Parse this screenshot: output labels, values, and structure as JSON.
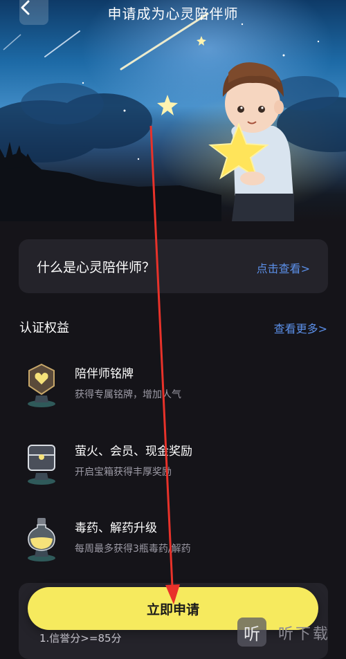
{
  "header": {
    "title": "申请成为心灵陪伴师"
  },
  "info_card": {
    "question": "什么是心灵陪伴师？",
    "link": "点击查看>"
  },
  "benefits_section": {
    "title": "认证权益",
    "more": "查看更多>",
    "items": [
      {
        "title": "陪伴师铭牌",
        "desc": "获得专属铭牌，增加人气",
        "icon": "badge-icon"
      },
      {
        "title": "萤火、会员、现金奖励",
        "desc": "开启宝箱获得丰厚奖励",
        "icon": "treasure-chest-icon"
      },
      {
        "title": "毒药、解药升级",
        "desc": "每周最多获得3瓶毒药/解药",
        "icon": "potion-bottle-icon"
      }
    ]
  },
  "apply_button": {
    "label": "立即申请"
  },
  "requirements": {
    "first": "1.信誉分>=85分"
  },
  "watermark": {
    "glyph": "听",
    "text": "听下载"
  },
  "colors": {
    "accent_link": "#5b8fe8",
    "button": "#f6ea5e",
    "annotation_arrow": "#e8322a"
  }
}
